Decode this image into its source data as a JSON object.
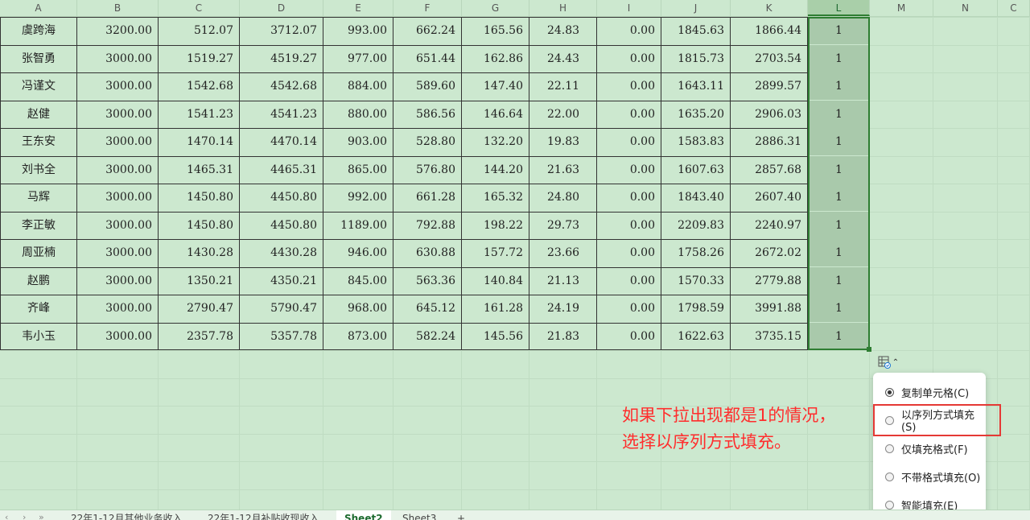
{
  "columns": [
    "A",
    "B",
    "C",
    "D",
    "E",
    "F",
    "G",
    "H",
    "I",
    "J",
    "K",
    "L",
    "M",
    "N",
    "C"
  ],
  "active_column": "L",
  "rows": [
    [
      "虞跨海",
      "3200.00",
      "512.07",
      "3712.07",
      "993.00",
      "662.24",
      "165.56",
      "24.83",
      "0.00",
      "1845.63",
      "1866.44",
      "1"
    ],
    [
      "张智勇",
      "3000.00",
      "1519.27",
      "4519.27",
      "977.00",
      "651.44",
      "162.86",
      "24.43",
      "0.00",
      "1815.73",
      "2703.54",
      "1"
    ],
    [
      "冯谨文",
      "3000.00",
      "1542.68",
      "4542.68",
      "884.00",
      "589.60",
      "147.40",
      "22.11",
      "0.00",
      "1643.11",
      "2899.57",
      "1"
    ],
    [
      "赵健",
      "3000.00",
      "1541.23",
      "4541.23",
      "880.00",
      "586.56",
      "146.64",
      "22.00",
      "0.00",
      "1635.20",
      "2906.03",
      "1"
    ],
    [
      "王东安",
      "3000.00",
      "1470.14",
      "4470.14",
      "903.00",
      "528.80",
      "132.20",
      "19.83",
      "0.00",
      "1583.83",
      "2886.31",
      "1"
    ],
    [
      "刘书全",
      "3000.00",
      "1465.31",
      "4465.31",
      "865.00",
      "576.80",
      "144.20",
      "21.63",
      "0.00",
      "1607.63",
      "2857.68",
      "1"
    ],
    [
      "马辉",
      "3000.00",
      "1450.80",
      "4450.80",
      "992.00",
      "661.28",
      "165.32",
      "24.80",
      "0.00",
      "1843.40",
      "2607.40",
      "1"
    ],
    [
      "李正敏",
      "3000.00",
      "1450.80",
      "4450.80",
      "1189.00",
      "792.88",
      "198.22",
      "29.73",
      "0.00",
      "2209.83",
      "2240.97",
      "1"
    ],
    [
      "周亚楠",
      "3000.00",
      "1430.28",
      "4430.28",
      "946.00",
      "630.88",
      "157.72",
      "23.66",
      "0.00",
      "1758.26",
      "2672.02",
      "1"
    ],
    [
      "赵鹏",
      "3000.00",
      "1350.21",
      "4350.21",
      "845.00",
      "563.36",
      "140.84",
      "21.13",
      "0.00",
      "1570.33",
      "2779.88",
      "1"
    ],
    [
      "齐峰",
      "3000.00",
      "2790.47",
      "5790.47",
      "968.00",
      "645.12",
      "161.28",
      "24.19",
      "0.00",
      "1798.59",
      "3991.88",
      "1"
    ],
    [
      "韦小玉",
      "3000.00",
      "2357.78",
      "5357.78",
      "873.00",
      "582.24",
      "145.56",
      "21.83",
      "0.00",
      "1622.63",
      "3735.15",
      "1"
    ]
  ],
  "autofill": {
    "button_icon": "autofill-options-icon",
    "caret": "⌃",
    "options": [
      {
        "label": "复制单元格(C)",
        "checked": true
      },
      {
        "label": "以序列方式填充(S)",
        "checked": false
      },
      {
        "label": "仅填充格式(F)",
        "checked": false
      },
      {
        "label": "不带格式填充(O)",
        "checked": false
      },
      {
        "label": "智能填充(E)",
        "checked": false
      }
    ],
    "highlighted_option": 1
  },
  "annotation": {
    "line1": "如果下拉出现都是1的情况，",
    "line2": "选择以序列方式填充。",
    "color": "#ff2d2d"
  },
  "sheet_tabs": {
    "nav": [
      "‹",
      "›",
      "»"
    ],
    "tabs": [
      {
        "label": "22年1-12月其他业务收入",
        "active": false
      },
      {
        "label": "22年1-12月补贴收现收入",
        "active": false
      },
      {
        "label": "Sheet2",
        "active": true
      },
      {
        "label": "Sheet3",
        "active": false
      }
    ],
    "add_label": "+"
  },
  "colors": {
    "sheet_background": "#cce8cf",
    "selection_border": "#2e7d32",
    "highlight_box": "#e53935"
  }
}
